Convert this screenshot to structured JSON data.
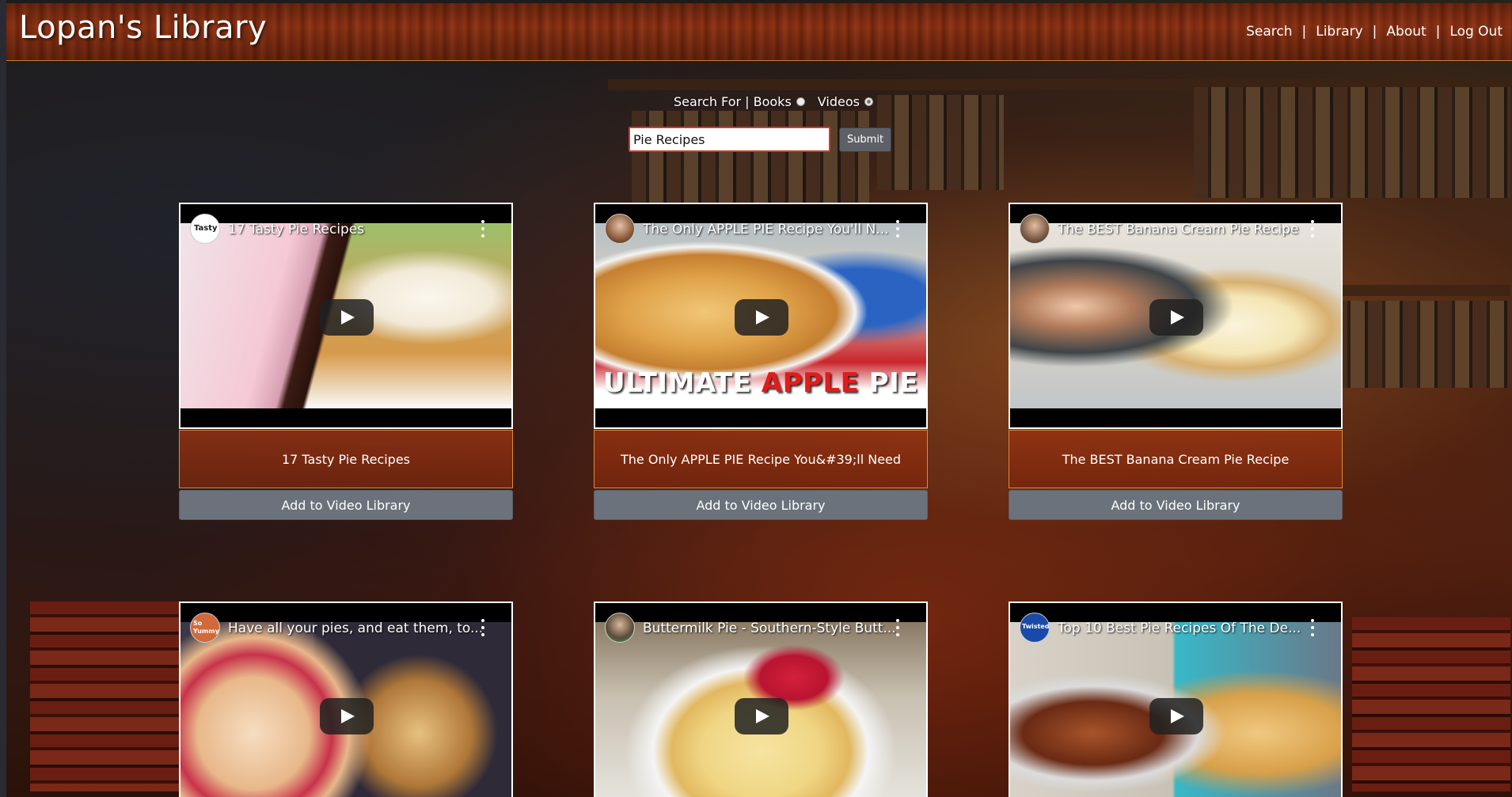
{
  "header": {
    "brand": "Lopan's Library",
    "nav": [
      {
        "label": "Search"
      },
      {
        "label": "Library"
      },
      {
        "label": "About"
      },
      {
        "label": "Log Out"
      }
    ],
    "separator": "|"
  },
  "search": {
    "label": "Search For | Books",
    "option_books": "Books",
    "option_videos": "Videos",
    "selected": "Videos",
    "query": "Pie Recipes",
    "submit_label": "Submit"
  },
  "videos": [
    {
      "thumb_title": "17 Tasty Pie Recipes",
      "caption": "17 Tasty Pie Recipes",
      "button": "Add to Video Library",
      "channel": "Tasty"
    },
    {
      "thumb_title": "The Only APPLE PIE Recipe You'll N...",
      "caption": "The Only APPLE PIE Recipe You&#39;ll Need",
      "button": "Add to Video Library",
      "channel": "avatar",
      "banner_white": "ULTIMATE ",
      "banner_red": "APPLE",
      "banner_end": " PIE"
    },
    {
      "thumb_title": "The BEST Banana Cream Pie Recipe",
      "caption": "The BEST Banana Cream Pie Recipe",
      "button": "Add to Video Library",
      "channel": "avatar"
    },
    {
      "thumb_title": "Have all your pies, and eat them, to...",
      "channel": "So Yummy"
    },
    {
      "thumb_title": "Buttermilk Pie - Southern-Style Butt...",
      "channel": "avatar"
    },
    {
      "thumb_title": "Top 10 Best Pie Recipes Of The De...",
      "channel": "Twisted"
    }
  ],
  "colors": {
    "header": "#7a2a10",
    "caption": "#96321",
    "button": "#6b727b",
    "input_border": "#c44030"
  }
}
